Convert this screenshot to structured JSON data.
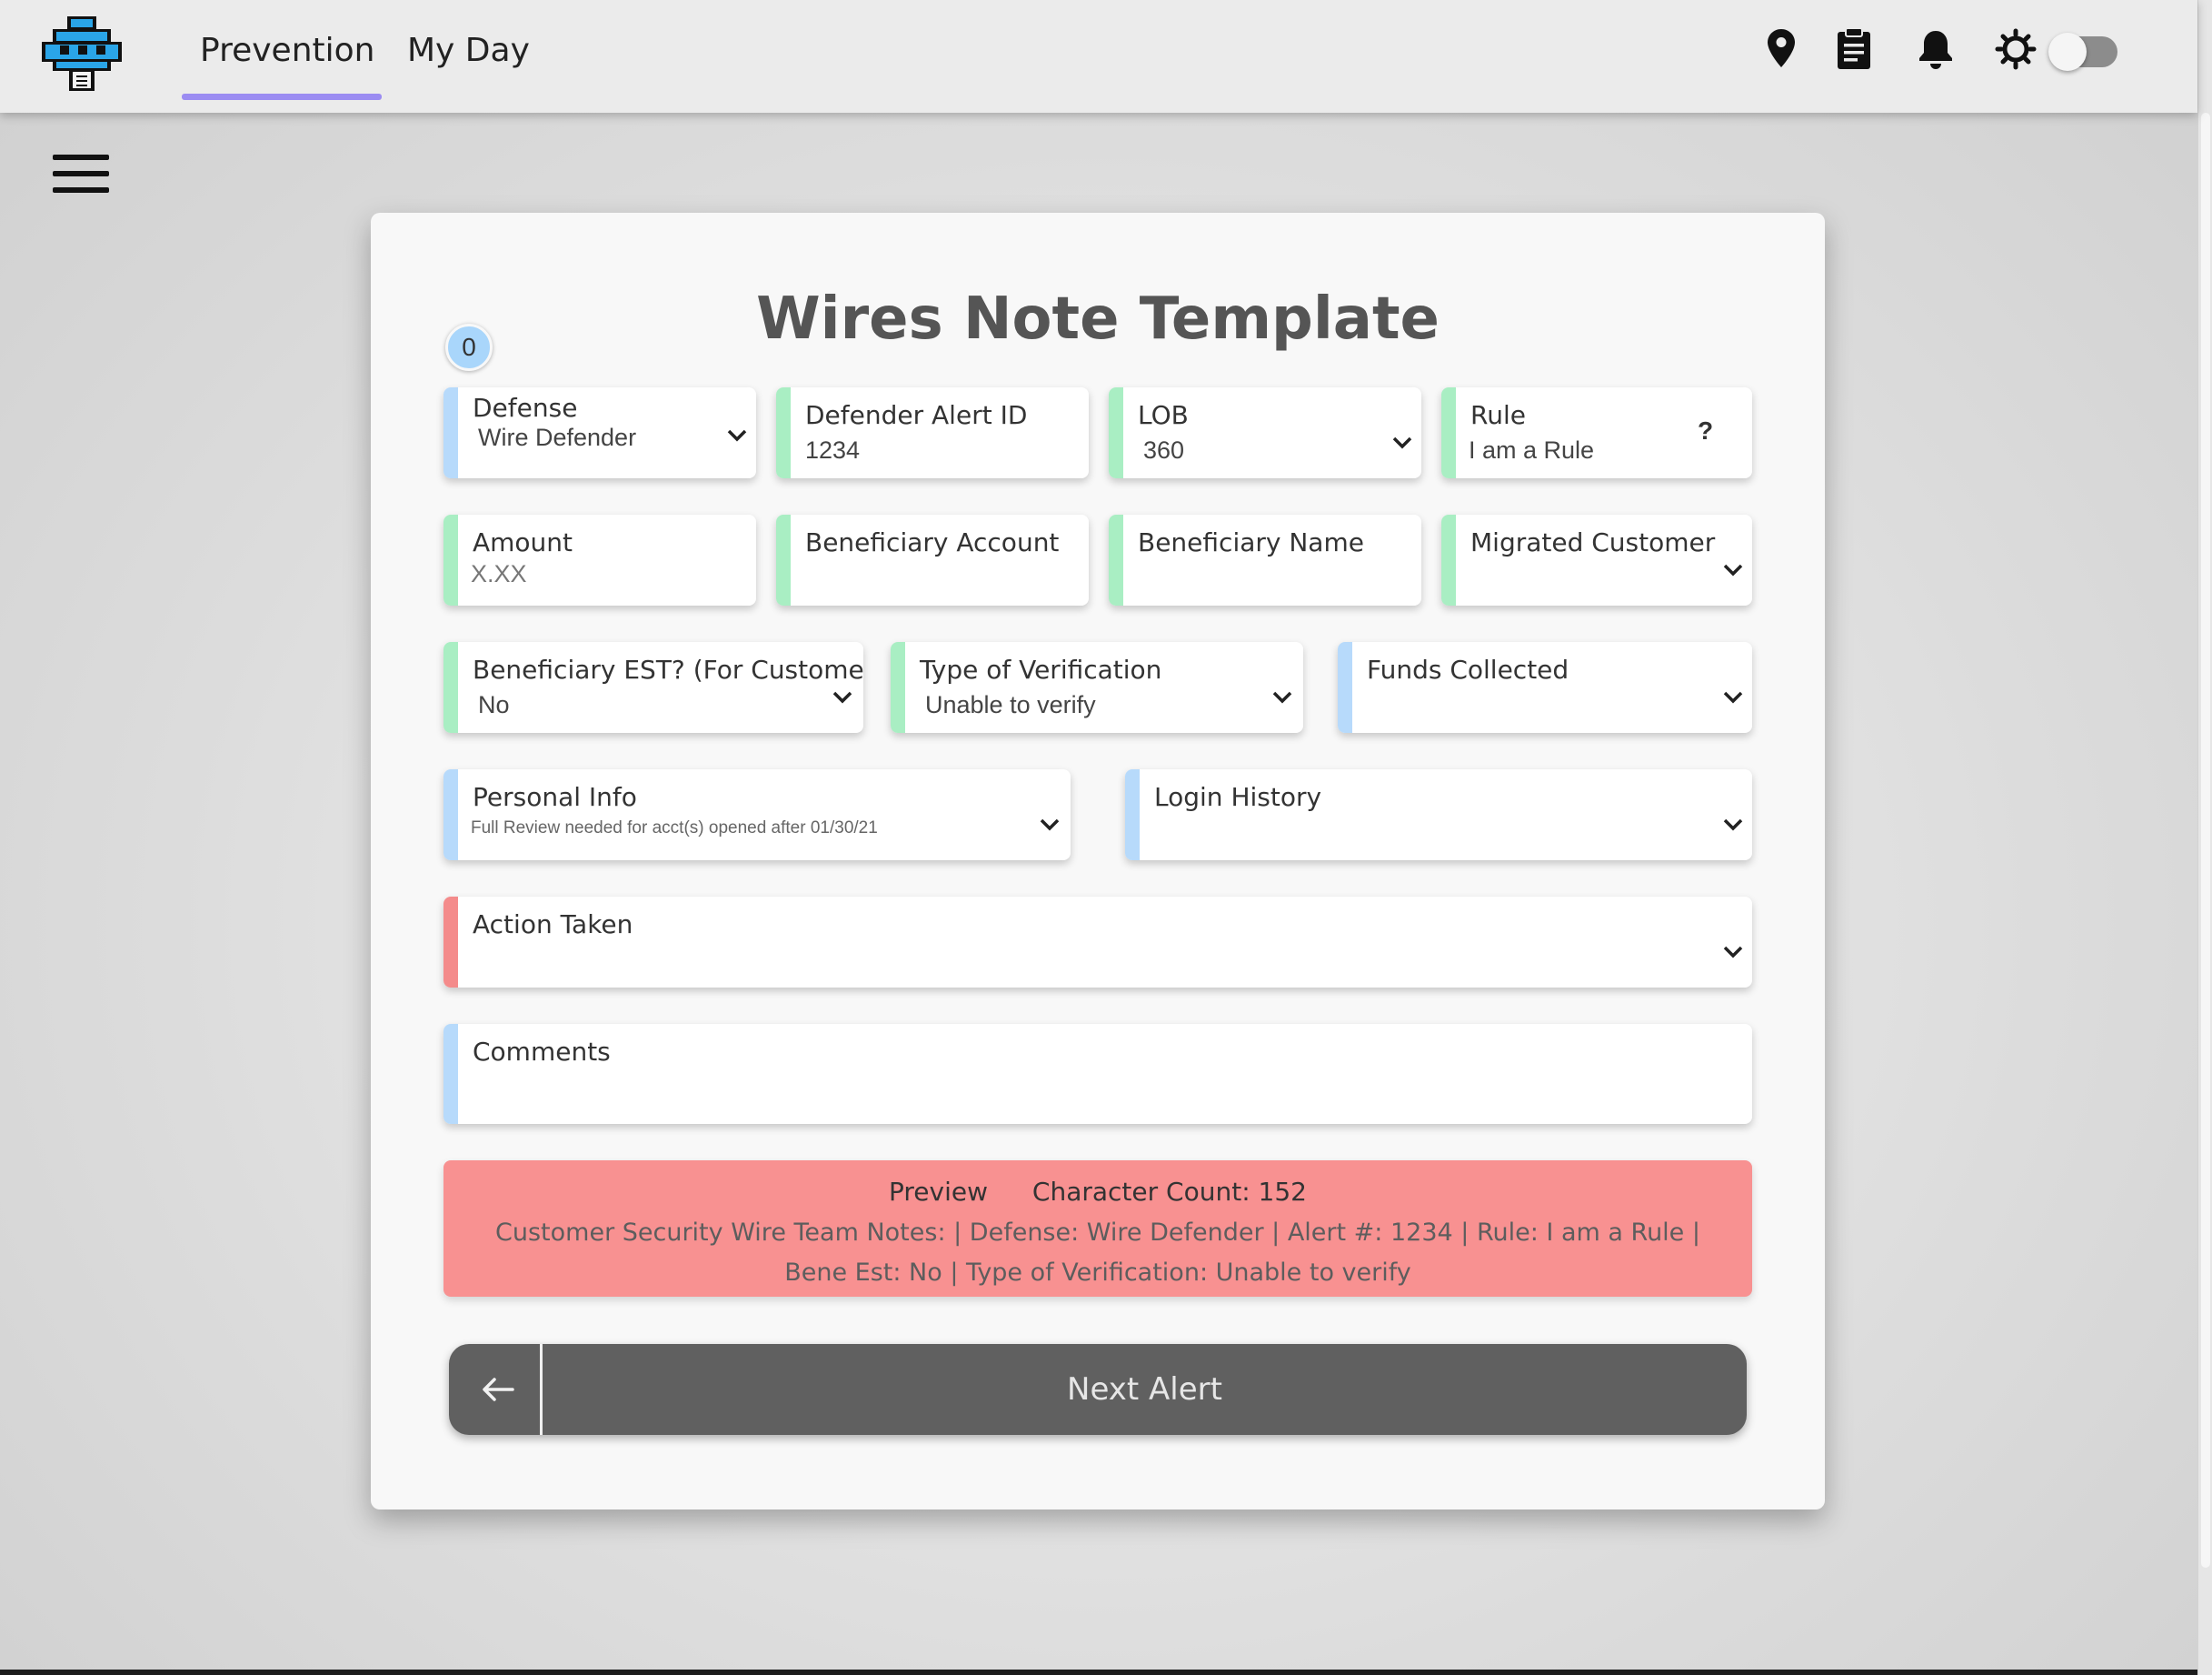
{
  "header": {
    "tabs": [
      {
        "label": "Prevention",
        "active": true
      },
      {
        "label": "My Day",
        "active": false
      }
    ],
    "icons": [
      "location-pin-icon",
      "clipboard-icon",
      "bell-icon",
      "sun-icon",
      "moon-icon"
    ],
    "theme_toggle": {
      "dark_mode": false
    },
    "accent_color": "#9b8cf2"
  },
  "form": {
    "title": "Wires Note Template",
    "counter": "0",
    "fields": {
      "defense": {
        "label": "Defense",
        "value": "Wire Defender"
      },
      "defender_alert_id": {
        "label": "Defender Alert ID",
        "value": "1234"
      },
      "lob": {
        "label": "LOB",
        "value": "360"
      },
      "rule": {
        "label": "Rule",
        "value": "I am a Rule",
        "help": "?"
      },
      "amount": {
        "label": "Amount",
        "placeholder": "X.XX"
      },
      "beneficiary_account": {
        "label": "Beneficiary Account",
        "value": ""
      },
      "beneficiary_name": {
        "label": "Beneficiary Name",
        "value": ""
      },
      "migrated_customer": {
        "label": "Migrated Customer",
        "value": ""
      },
      "beneficiary_est": {
        "label": "Beneficiary EST? (For Customer)",
        "value": "No"
      },
      "type_of_verification": {
        "label": "Type of Verification",
        "value": "Unable to verify"
      },
      "funds_collected": {
        "label": "Funds Collected",
        "value": ""
      },
      "personal_info": {
        "label": "Personal Info",
        "hint": "Full Review needed for acct(s) opened after 01/30/21"
      },
      "login_history": {
        "label": "Login History",
        "value": ""
      },
      "action_taken": {
        "label": "Action Taken",
        "value": ""
      },
      "comments": {
        "label": "Comments",
        "value": ""
      }
    },
    "status_colors": {
      "blue": "#b7dafb",
      "green": "#a9eec3",
      "red": "#f48b8b"
    }
  },
  "preview": {
    "label": "Preview",
    "character_count": "Character Count: 152",
    "text": "Customer Security Wire Team Notes: | Defense: Wire Defender | Alert #: 1234 | Rule: I am a Rule | Bene Est: No | Type of Verification: Unable to verify",
    "background": "#f89191"
  },
  "actions": {
    "back_icon": "arrow-left-icon",
    "next_label": "Next Alert"
  }
}
